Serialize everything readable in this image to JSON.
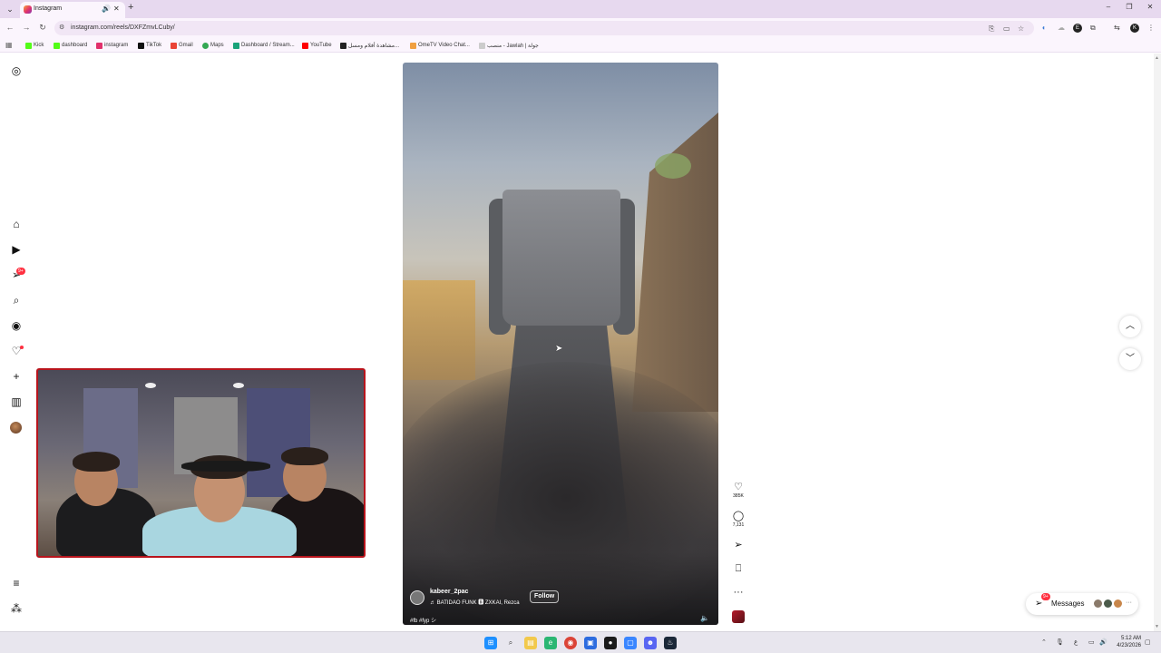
{
  "browser": {
    "tab_title": "Instagram",
    "speaker_icon": "speaker-icon",
    "url": "instagram.com/reels/DXFZmvLCuby/",
    "bookmarks": [
      {
        "label": "Kick",
        "color": "#53fc18"
      },
      {
        "label": "dashboard",
        "color": "#53fc18"
      },
      {
        "label": "instagram",
        "color": "#e1306c"
      },
      {
        "label": "TikTok",
        "color": "#111111"
      },
      {
        "label": "Gmail",
        "color": "#ea4335"
      },
      {
        "label": "Maps",
        "color": "#34a853"
      },
      {
        "label": "Dashboard / Stream...",
        "color": "#1aa37a"
      },
      {
        "label": "YouTube",
        "color": "#ff0000"
      },
      {
        "label": "مشاهدة أفلام ومسل...",
        "color": "#222222"
      },
      {
        "label": "OmeTV Video Chat...",
        "color": "#f0a040"
      },
      {
        "label": "منصب - Jawlah | جولة",
        "color": "#cccccc"
      }
    ]
  },
  "reel": {
    "author": "kabeer_2pac",
    "audio": "♬ BATIDAO FUNK 🅱 ZXKAI, Rezca",
    "follow_label": "Follow",
    "hashtags": "#fb #fyp シ",
    "likes": "385K",
    "comments": "7,131"
  },
  "sidebar": {
    "notif_badge": "9+"
  },
  "messages": {
    "label": "Messages",
    "badge": "9+",
    "more": "···"
  },
  "taskbar": {
    "time": "5:12 AM",
    "date": "4/23/2026"
  },
  "colors": {
    "accent_red": "#ff3040",
    "tab_bar": "#e7d9ef",
    "webcam_frame": "#b8141c"
  }
}
